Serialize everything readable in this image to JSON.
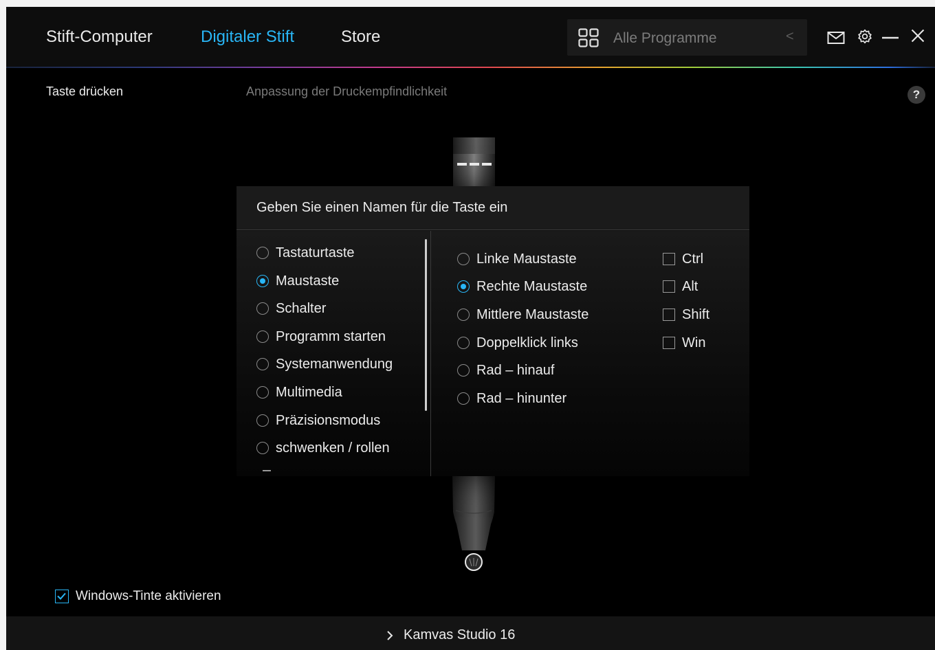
{
  "header": {
    "tabs": [
      {
        "label": "Stift-Computer",
        "active": false
      },
      {
        "label": "Digitaler Stift",
        "active": true
      },
      {
        "label": "Store",
        "active": false
      }
    ],
    "program_selector": {
      "label": "Alle Programme",
      "icon": "grid-icon",
      "arrow": "<"
    },
    "icons": [
      "mail-icon",
      "gear-icon",
      "minimize-icon",
      "close-icon"
    ],
    "accent_color": "#29b6f6"
  },
  "subtabs": {
    "press_key": "Taste drücken",
    "pressure": "Anpassung der Druckempfindlichkeit",
    "help": "?"
  },
  "dialog": {
    "title": "Geben Sie einen Namen für die Taste ein",
    "left_options": [
      {
        "label": "Tastaturtaste",
        "selected": false
      },
      {
        "label": "Maustaste",
        "selected": true
      },
      {
        "label": "Schalter",
        "selected": false
      },
      {
        "label": "Programm starten",
        "selected": false
      },
      {
        "label": "Systemanwendung",
        "selected": false
      },
      {
        "label": "Multimedia",
        "selected": false
      },
      {
        "label": "Präzisionsmodus",
        "selected": false
      },
      {
        "label": "schwenken / rollen",
        "selected": false
      }
    ],
    "mouse_options": [
      {
        "label": "Linke Maustaste",
        "selected": false
      },
      {
        "label": "Rechte Maustaste",
        "selected": true
      },
      {
        "label": "Mittlere Maustaste",
        "selected": false
      },
      {
        "label": "Doppelklick links",
        "selected": false
      },
      {
        "label": "Rad – hinauf",
        "selected": false
      },
      {
        "label": "Rad – hinunter",
        "selected": false
      }
    ],
    "modifiers": [
      {
        "label": "Ctrl",
        "checked": false
      },
      {
        "label": "Alt",
        "checked": false
      },
      {
        "label": "Shift",
        "checked": false
      },
      {
        "label": "Win",
        "checked": false
      }
    ]
  },
  "windows_ink": {
    "label": "Windows-Tinte aktivieren",
    "checked": true
  },
  "footer": {
    "device": "Kamvas Studio 16"
  }
}
